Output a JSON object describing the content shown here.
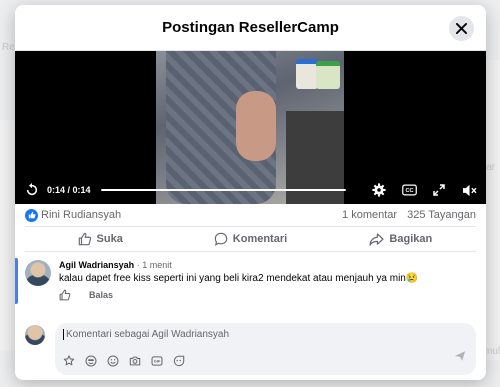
{
  "modal": {
    "title": "Postingan ResellerCamp"
  },
  "video": {
    "time": "0:14 / 0:14",
    "progress": 1.0
  },
  "stats": {
    "reactor": "Rini Rudiansyah",
    "comments": "1 komentar",
    "views": "325 Tayangan"
  },
  "actions": {
    "like": "Suka",
    "comment": "Komentari",
    "share": "Bagikan"
  },
  "comment": {
    "author": "Agil Wadriansyah",
    "time": "· 1 menit",
    "text": "kalau dapet free kiss seperti ini yang beli kira2 mendekat atau menjauh ya min😢",
    "reply": "Balas"
  },
  "composer": {
    "placeholder": "Komentari sebagai Agil Wadriansyah"
  },
  "background": {
    "left_text": "Re",
    "right_text": "lar",
    "right_text2": "mulu"
  },
  "colors": {
    "accent": "#1877f2",
    "video_bg": "#000000",
    "secondary_text": "#65676b"
  }
}
